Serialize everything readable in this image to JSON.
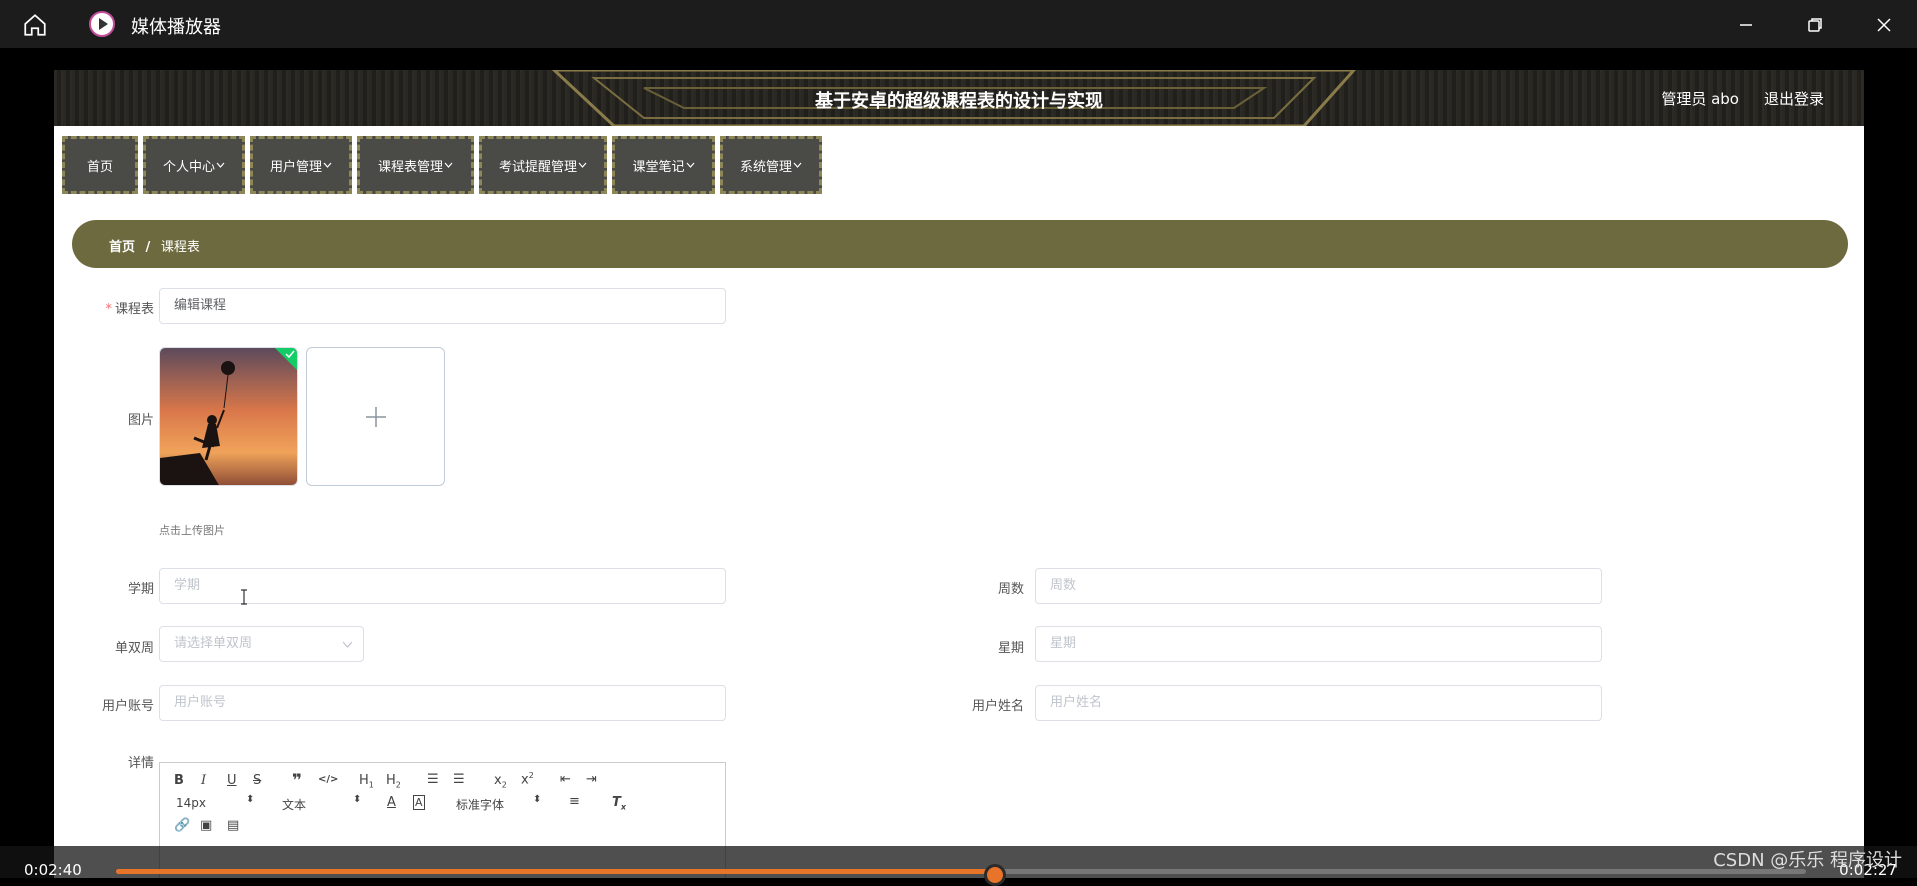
{
  "window": {
    "title": "媒体播放器"
  },
  "site": {
    "title": "基于安卓的超级课程表的设计与实现",
    "user": "管理员 abo",
    "logout": "退出登录"
  },
  "nav": [
    "首页",
    "个人中心",
    "用户管理",
    "课程表管理",
    "考试提醒管理",
    "课堂笔记",
    "系统管理"
  ],
  "breadcrumb": {
    "home": "首页",
    "sep": "/",
    "current": "课程表"
  },
  "form": {
    "course": {
      "label": "课程表",
      "value": "编辑课程"
    },
    "image": {
      "label": "图片",
      "hint": "点击上传图片"
    },
    "term": {
      "label": "学期",
      "placeholder": "学期"
    },
    "weeks": {
      "label": "周数",
      "placeholder": "周数"
    },
    "oddeven": {
      "label": "单双周",
      "placeholder": "请选择单双周"
    },
    "weekday": {
      "label": "星期",
      "placeholder": "星期"
    },
    "account": {
      "label": "用户账号",
      "placeholder": "用户账号"
    },
    "username": {
      "label": "用户姓名",
      "placeholder": "用户姓名"
    },
    "detail": {
      "label": "详情"
    }
  },
  "editor": {
    "font_size": "14px",
    "header": "文本",
    "font": "标准字体"
  },
  "player": {
    "elapsed": "0:02:40",
    "remaining": "0:02:27",
    "progress": 0.52
  },
  "watermark": "CSDN @乐乐 程序设计"
}
